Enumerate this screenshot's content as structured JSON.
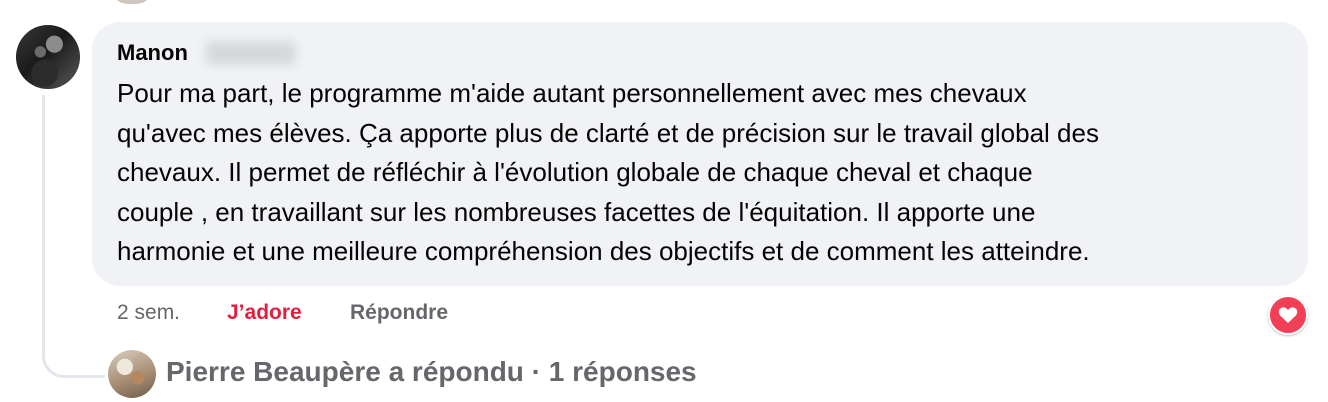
{
  "comment": {
    "author": "Manon",
    "text": "Pour ma part, le programme m'aide autant personnellement avec mes chevaux\nqu'avec mes élèves. Ça apporte plus de clarté et de précision sur le travail global des\nchevaux. Il permet de réfléchir à l'évolution globale de chaque cheval et chaque\ncouple , en travaillant sur les nombreuses facettes de l'équitation. Il apporte une\nharmonie et une meilleure compréhension des objectifs et de comment les atteindre.",
    "time": "2 sem.",
    "like_label": "J’adore",
    "reply_label": "Répondre",
    "reaction_icon": "heart-icon",
    "reaction_color": "#f33e58"
  },
  "replies": {
    "summary": "Pierre Beaupère a répondu · 1 réponses"
  }
}
